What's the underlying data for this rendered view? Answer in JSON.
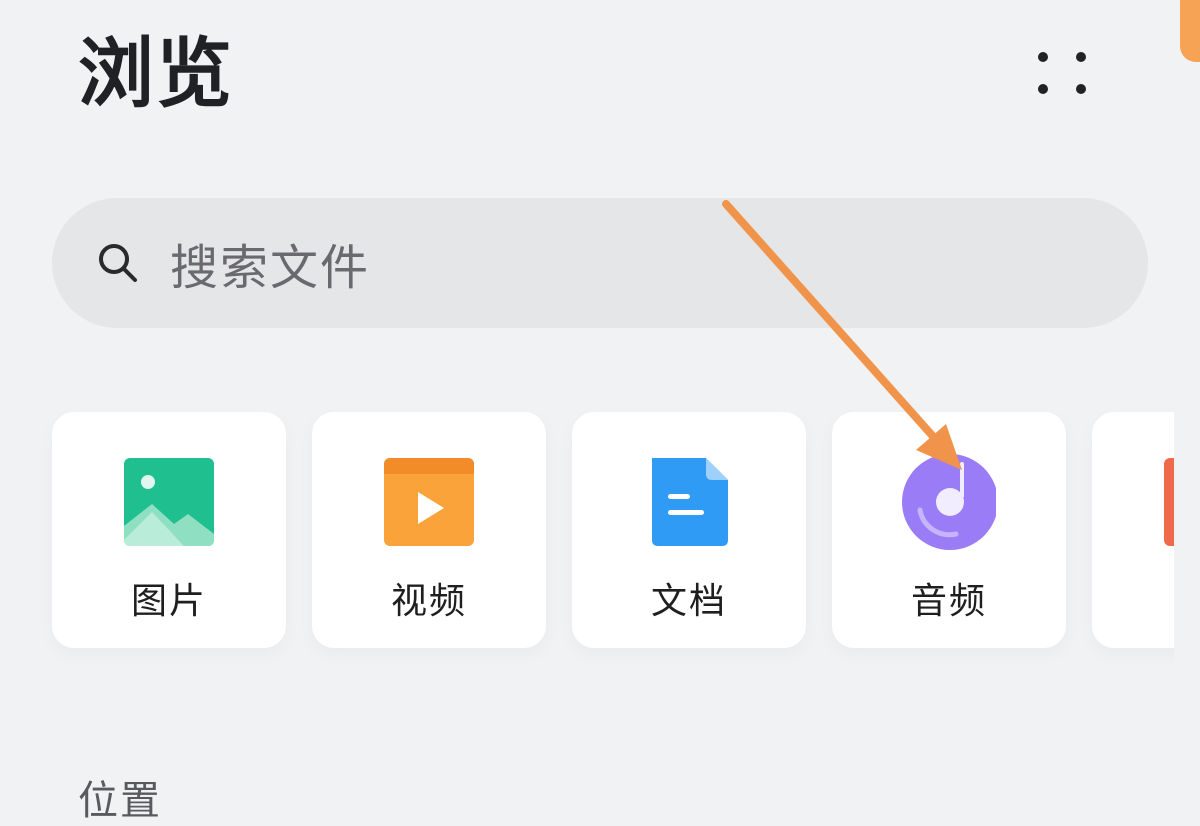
{
  "header": {
    "title": "浏览",
    "more_icon": "more-dots-icon"
  },
  "search": {
    "placeholder": "搜索文件",
    "icon": "search-icon"
  },
  "categories": [
    {
      "label": "图片",
      "icon": "image-icon",
      "color": "#1fbf8f"
    },
    {
      "label": "视频",
      "icon": "video-icon",
      "color": "#f9a33a"
    },
    {
      "label": "文档",
      "icon": "document-icon",
      "color": "#2f9bf5"
    },
    {
      "label": "音频",
      "icon": "audio-icon",
      "color": "#9b7cf7"
    },
    {
      "label": "",
      "icon": "app-icon",
      "color": "#ee6a4a"
    }
  ],
  "section": {
    "title": "位置"
  },
  "colors": {
    "background": "#f1f2f4",
    "search_bg": "#e5e6e8",
    "annotation_arrow": "#f0944c"
  }
}
